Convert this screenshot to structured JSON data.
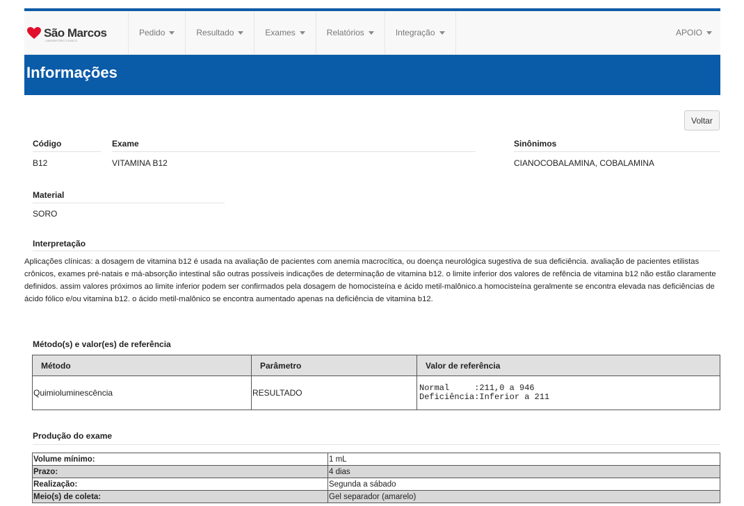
{
  "brand": {
    "name": "São Marcos",
    "tagline": "LABORATÓRIO CLÍNICO",
    "heart_color": "#e0102d"
  },
  "nav": {
    "items": [
      {
        "label": "Pedido"
      },
      {
        "label": "Resultado"
      },
      {
        "label": "Exames"
      },
      {
        "label": "Relatórios"
      },
      {
        "label": "Integração"
      }
    ],
    "user_menu": "APOIO"
  },
  "page": {
    "title": "Informações",
    "back_button": "Voltar",
    "accent_color": "#0a5ba8"
  },
  "info": {
    "codigo_label": "Código",
    "codigo": "B12",
    "exame_label": "Exame",
    "exame": "VITAMINA B12",
    "sinonimos_label": "Sinônimos",
    "sinonimos": "CIANOCOBALAMINA, COBALAMINA",
    "material_label": "Material",
    "material": "SORO"
  },
  "interpretacao": {
    "label": "Interpretação",
    "text": "Aplicações clínicas: a dosagem de vitamina b12 é usada na avaliação de pacientes com anemia macrocítica, ou doença neurológica sugestiva de sua deficiência. avaliação de pacientes etilistas crônicos, exames pré-natais e má-absorção intestinal são outras possíveis indicações de determinação de vitamina b12. o limite inferior dos valores de refência de vitamina b12 não estão claramente definidos. assim valores próximos ao limite inferior podem ser confirmados pela dosagem de homocisteína e ácido metil-malônico.a homocisteína geralmente se encontra elevada nas deficiências de ácido fólico e/ou vitamina b12. o ácido metil-malônico se encontra aumentado apenas na deficiência de vitamina b12."
  },
  "metodos": {
    "label": "Método(s) e valor(es) de referência",
    "headers": [
      "Método",
      "Parâmetro",
      "Valor de referência"
    ],
    "rows": [
      {
        "metodo": "Quimioluminescência",
        "parametro": "RESULTADO",
        "valor": "Normal     :211,0 a 946\nDeficiência:Inferior a 211"
      }
    ]
  },
  "producao": {
    "label": "Produção do exame",
    "rows": [
      {
        "k": "Volume mínimo:",
        "v": "1 mL"
      },
      {
        "k": "Prazo:",
        "v": "4 dias"
      },
      {
        "k": "Realização:",
        "v": "Segunda a sábado"
      },
      {
        "k": "Meio(s) de coleta:",
        "v": "Gel separador (amarelo)"
      }
    ]
  }
}
